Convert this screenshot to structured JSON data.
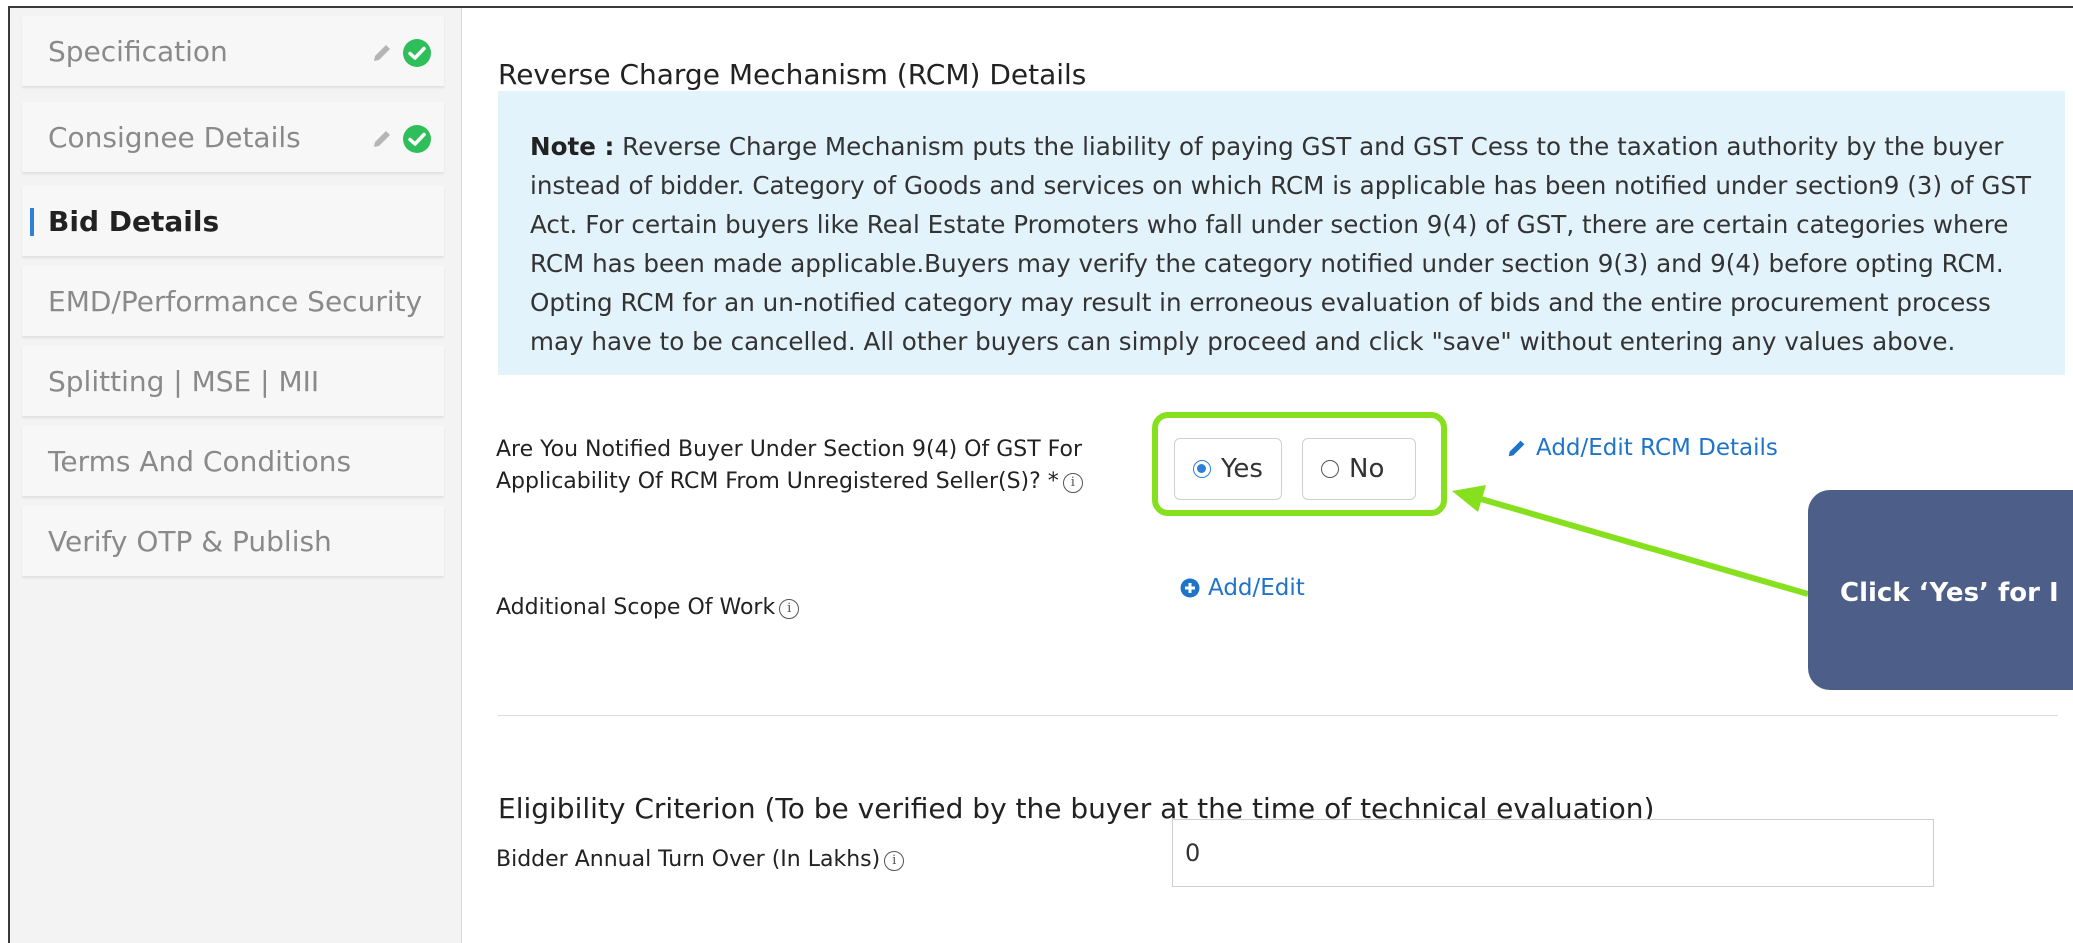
{
  "sidebar": {
    "items": [
      {
        "label": "Specification",
        "completed": true
      },
      {
        "label": "Consignee Details",
        "completed": true
      },
      {
        "label": "Bid Details",
        "active": true
      },
      {
        "label": "EMD/Performance Security"
      },
      {
        "label": "Splitting | MSE | MII"
      },
      {
        "label": "Terms And Conditions"
      },
      {
        "label": "Verify OTP & Publish"
      }
    ]
  },
  "rcm": {
    "title": "Reverse Charge Mechanism (RCM) Details",
    "note_label": "Note :",
    "note_text": "Reverse Charge Mechanism puts the liability of paying GST and GST Cess to the taxation authority by the buyer instead of bidder. Category of Goods and services on which RCM is applicable has been notified under section9 (3) of GST Act. For certain buyers like Real Estate Promoters who fall under section 9(4) of GST, there are certain categories where RCM has been made applicable.Buyers may verify the category notified under section 9(3) and 9(4) before opting RCM. Opting RCM for an un-notified category may result in erroneous evaluation of bids and the entire procurement process may have to be cancelled. All other buyers can simply proceed and click \"save\" without entering any values above.",
    "question_line1": "Are You Notified Buyer Under Section 9(4) Of GST For",
    "question_line2": "Applicability Of RCM From Unregistered Seller(S)? *",
    "yes_label": "Yes",
    "no_label": "No",
    "selected": "Yes",
    "add_edit_rcm_label": "Add/Edit RCM Details"
  },
  "scope": {
    "label": "Additional Scope Of Work",
    "add_edit_label": "Add/Edit"
  },
  "eligibility": {
    "title": "Eligibility Criterion (To be verified by the buyer at the time of technical evaluation)",
    "turnover_label": "Bidder Annual Turn Over (In Lakhs)",
    "turnover_value": "0"
  },
  "callout": {
    "text": "Click ‘Yes’ for I"
  },
  "colors": {
    "accent_blue": "#2e7fd8",
    "link_blue": "#1f73c9",
    "success_green": "#2fbf5a",
    "highlight_green": "#86e01e",
    "note_bg": "#e3f3fb",
    "callout_bg": "#4d5f88"
  }
}
